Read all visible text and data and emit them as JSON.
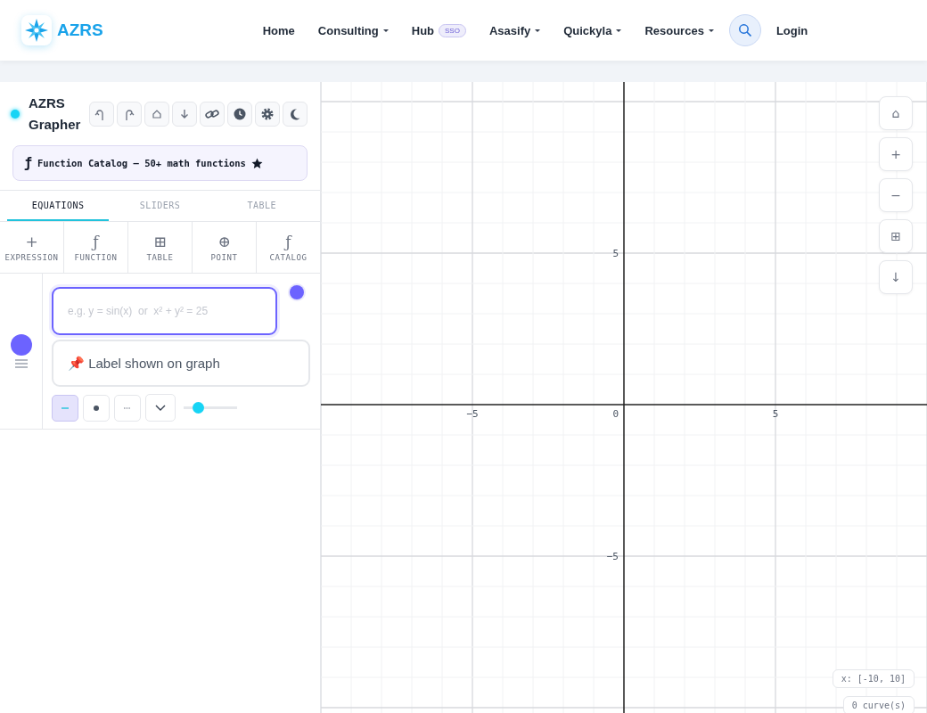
{
  "navbar": {
    "brand": "AZRS",
    "items": [
      {
        "label": "Home",
        "has_menu": false
      },
      {
        "label": "Consulting",
        "has_menu": true
      },
      {
        "label": "Hub",
        "has_menu": false,
        "badge": "SSO"
      },
      {
        "label": "Asasify",
        "has_menu": true
      },
      {
        "label": "Quickyla",
        "has_menu": true
      },
      {
        "label": "Resources",
        "has_menu": true
      }
    ],
    "login": "Login"
  },
  "sidebar": {
    "title": "AZRS Grapher",
    "toolbar": [
      {
        "kind": "undo"
      },
      {
        "kind": "redo"
      },
      {
        "kind": "home"
      },
      {
        "kind": "download"
      },
      {
        "kind": "link"
      },
      {
        "kind": "history"
      },
      {
        "kind": "settings"
      },
      {
        "kind": "theme"
      }
    ],
    "catalog": {
      "icon": "ƒ",
      "label": "Function Catalog — 50+ math functions"
    },
    "tabs": [
      {
        "label": "EQUATIONS",
        "selected": true
      },
      {
        "label": "SLIDERS",
        "selected": false
      },
      {
        "label": "TABLE",
        "selected": false
      }
    ],
    "insert": [
      {
        "icon": "+",
        "label": "EXPRESSION"
      },
      {
        "icon": "ƒ",
        "label": "FUNCTION"
      },
      {
        "icon": "⊞",
        "label": "TABLE"
      },
      {
        "icon": "⊕",
        "label": "POINT"
      },
      {
        "icon": "ƒ",
        "label": "CATALOG"
      }
    ],
    "expressions": [
      {
        "color": "#6c63ff",
        "placeholder": "e.g. y = sin(x)  or  x² + y² = 25",
        "label_placeholder": "📌 Label shown on graph",
        "styles": [
          {
            "kind": "solid",
            "selected": true
          },
          {
            "kind": "dotted",
            "selected": false
          },
          {
            "kind": "dashed",
            "selected": false
          }
        ],
        "level": 0.27
      }
    ]
  },
  "graph": {
    "x_labels": [
      "−5",
      "0",
      "5"
    ],
    "y_labels": [
      "5",
      "−5"
    ],
    "controls": [
      "⌂",
      "+",
      "−",
      "⊞",
      "↓"
    ],
    "range": "x: [-10, 10]",
    "count": "0 curve(s)"
  }
}
